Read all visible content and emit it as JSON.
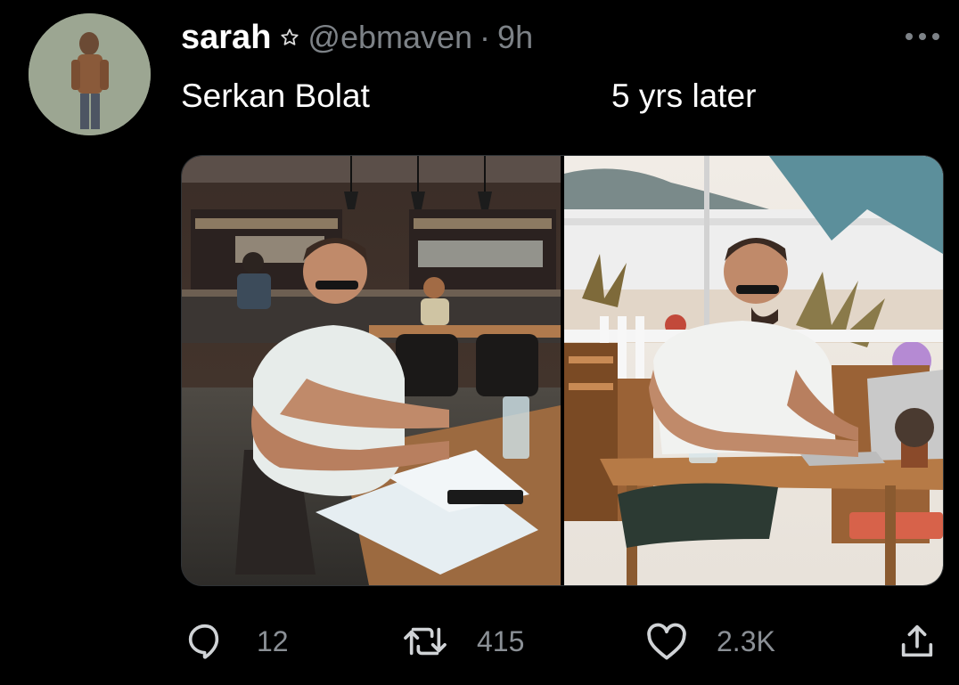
{
  "tweet": {
    "display_name": "sarah",
    "badge_icon": "star-icon",
    "handle": "@ebmaven",
    "separator": "·",
    "time": "9h",
    "text_left": "Serkan Bolat",
    "text_right": "5 yrs later",
    "media": [
      {
        "kind": "photo",
        "scene": "indoor-restaurant"
      },
      {
        "kind": "photo",
        "scene": "beach-terrace"
      }
    ]
  },
  "actions": {
    "reply": {
      "icon": "reply-icon",
      "count": "12"
    },
    "retweet": {
      "icon": "retweet-icon",
      "count": "415"
    },
    "like": {
      "icon": "heart-icon",
      "count": "2.3K"
    },
    "share": {
      "icon": "share-icon"
    }
  },
  "colors": {
    "background": "#000000",
    "text_primary": "#ffffff",
    "text_secondary": "#7d8287"
  }
}
